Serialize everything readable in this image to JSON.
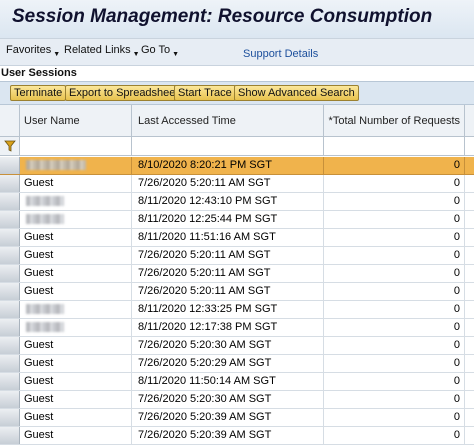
{
  "window": {
    "title": "Session Management: Resource Consumption"
  },
  "menu": {
    "favorites": "Favorites",
    "related_links": "Related Links",
    "go_to": "Go To",
    "support_details": "Support Details"
  },
  "section": {
    "title": "User Sessions"
  },
  "toolbar": {
    "terminate": "Terminate",
    "export": "Export to Spreadsheet",
    "start_trace": "Start Trace",
    "advanced_search": "Show Advanced Search"
  },
  "table": {
    "columns": [
      "User Name",
      "Last Accessed Time",
      "*Total Number of Requests"
    ],
    "rows": [
      {
        "user": "",
        "redacted": true,
        "time": "8/10/2020 8:20:21 PM SGT",
        "requests": "0",
        "selected": true
      },
      {
        "user": "Guest",
        "redacted": false,
        "time": "7/26/2020 5:20:11 AM SGT",
        "requests": "0"
      },
      {
        "user": "",
        "redacted": true,
        "time": "8/11/2020 12:43:10 PM SGT",
        "requests": "0"
      },
      {
        "user": "",
        "redacted": true,
        "time": "8/11/2020 12:25:44 PM SGT",
        "requests": "0"
      },
      {
        "user": "Guest",
        "redacted": false,
        "time": "8/11/2020 11:51:16 AM SGT",
        "requests": "0"
      },
      {
        "user": "Guest",
        "redacted": false,
        "time": "7/26/2020 5:20:11 AM SGT",
        "requests": "0"
      },
      {
        "user": "Guest",
        "redacted": false,
        "time": "7/26/2020 5:20:11 AM SGT",
        "requests": "0"
      },
      {
        "user": "Guest",
        "redacted": false,
        "time": "7/26/2020 5:20:11 AM SGT",
        "requests": "0"
      },
      {
        "user": "",
        "redacted": true,
        "time": "8/11/2020 12:33:25 PM SGT",
        "requests": "0"
      },
      {
        "user": "",
        "redacted": true,
        "time": "8/11/2020 12:17:38 PM SGT",
        "requests": "0"
      },
      {
        "user": "Guest",
        "redacted": false,
        "time": "7/26/2020 5:20:30 AM SGT",
        "requests": "0"
      },
      {
        "user": "Guest",
        "redacted": false,
        "time": "7/26/2020 5:20:29 AM SGT",
        "requests": "0"
      },
      {
        "user": "Guest",
        "redacted": false,
        "time": "8/11/2020 11:50:14 AM SGT",
        "requests": "0"
      },
      {
        "user": "Guest",
        "redacted": false,
        "time": "7/26/2020 5:20:30 AM SGT",
        "requests": "0"
      },
      {
        "user": "Guest",
        "redacted": false,
        "time": "7/26/2020 5:20:39 AM SGT",
        "requests": "0"
      },
      {
        "user": "Guest",
        "redacted": false,
        "time": "7/26/2020 5:20:39 AM SGT",
        "requests": "0"
      }
    ]
  },
  "icons": {
    "filter": "filter-funnel-icon",
    "dropdown": "caret-down-icon"
  },
  "colors": {
    "selected_row": "#f0b34c",
    "button": "#f2d26a",
    "link": "#1c4f9c"
  }
}
